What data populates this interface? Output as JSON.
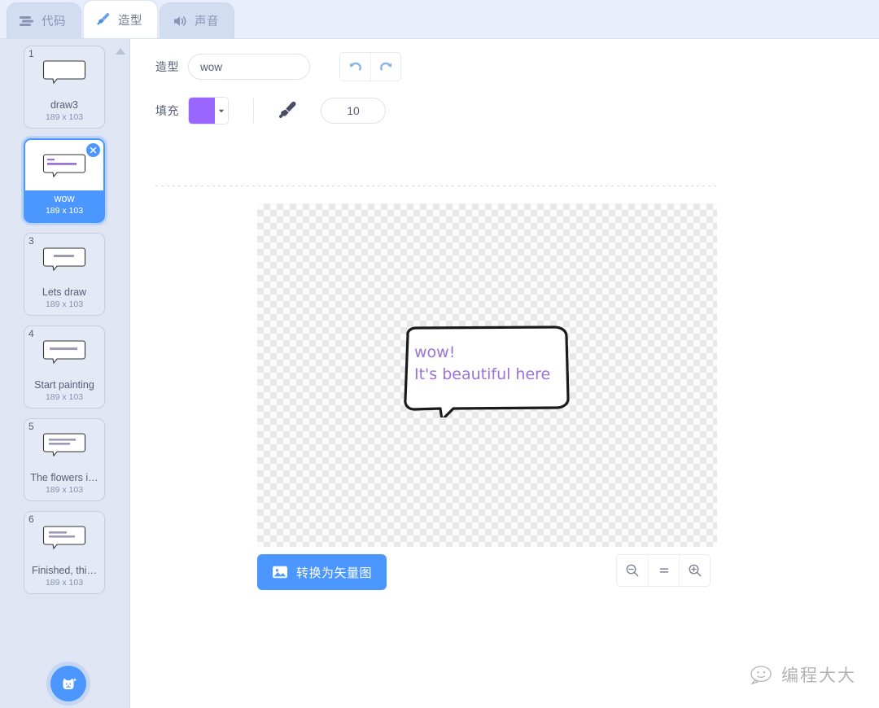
{
  "tabs": [
    {
      "id": "code",
      "label": "代码",
      "icon": "code-blocks-icon",
      "active": false
    },
    {
      "id": "costume",
      "label": "造型",
      "icon": "paintbrush-icon",
      "active": true
    },
    {
      "id": "sound",
      "label": "声音",
      "icon": "speaker-icon",
      "active": false
    }
  ],
  "sidebar": {
    "scroll_up_icon": "chevron-up-icon",
    "add_button_icon": "add-costume-cat-icon",
    "costumes": [
      {
        "index": "1",
        "name": "draw3",
        "size": "189 x 103",
        "selected": false,
        "thumb_text": ""
      },
      {
        "index": "2",
        "name": "wow",
        "size": "189 x 103",
        "selected": true,
        "thumb_text": "wow! It's beautiful here",
        "delete_icon": "close-icon"
      },
      {
        "index": "3",
        "name": "Lets draw",
        "size": "189 x 103",
        "selected": false,
        "thumb_text": "Let's draw"
      },
      {
        "index": "4",
        "name": "Start painting",
        "size": "189 x 103",
        "selected": false,
        "thumb_text": "Start painting"
      },
      {
        "index": "5",
        "name": "The flowers i…",
        "size": "189 x 103",
        "selected": false,
        "thumb_text": "The flowers is so beautiful!"
      },
      {
        "index": "6",
        "name": "Finished, thi…",
        "size": "189 x 103",
        "selected": false,
        "thumb_text": "Finished, this is beautiful!"
      }
    ]
  },
  "editor": {
    "costume_label": "造型",
    "costume_name": "wow",
    "costume_name_placeholder": "",
    "undo_icon": "undo-arrow-icon",
    "redo_icon": "redo-arrow-icon",
    "fill_label": "填充",
    "fill_color": "#9966FF",
    "fill_caret_icon": "caret-down-icon",
    "brush_icon": "brush-tool-icon",
    "brush_size": "10",
    "tools": [
      {
        "id": "brush",
        "icon": "paintbrush-icon",
        "active": true
      },
      {
        "id": "line",
        "icon": "line-icon",
        "active": false
      },
      {
        "id": "ellipse",
        "icon": "ellipse-icon",
        "active": false
      },
      {
        "id": "rectangle",
        "icon": "rectangle-icon",
        "active": false
      },
      {
        "id": "text",
        "icon": "text-icon",
        "active": false
      },
      {
        "id": "fill",
        "icon": "paint-bucket-icon",
        "active": false
      },
      {
        "id": "eraser",
        "icon": "eraser-icon",
        "active": false
      },
      {
        "id": "select",
        "icon": "select-arrow-icon",
        "active": false
      }
    ],
    "canvas": {
      "drawing": "speech-bubble-with-text",
      "text_line1": "wow!",
      "text_line2": "It's beautiful here",
      "text_color": "#9b72d6"
    },
    "convert_button": {
      "label": "转换为矢量图",
      "icon": "image-icon",
      "color": "#4C97FF"
    },
    "zoom_controls": [
      {
        "id": "zoom-out",
        "icon": "magnifier-minus-icon",
        "label": "−"
      },
      {
        "id": "zoom-reset",
        "icon": "equals-icon",
        "label": "="
      },
      {
        "id": "zoom-in",
        "icon": "magnifier-plus-icon",
        "label": "+"
      }
    ]
  },
  "watermark": {
    "text": "编程大大",
    "icon": "cartoon-face-icon"
  }
}
